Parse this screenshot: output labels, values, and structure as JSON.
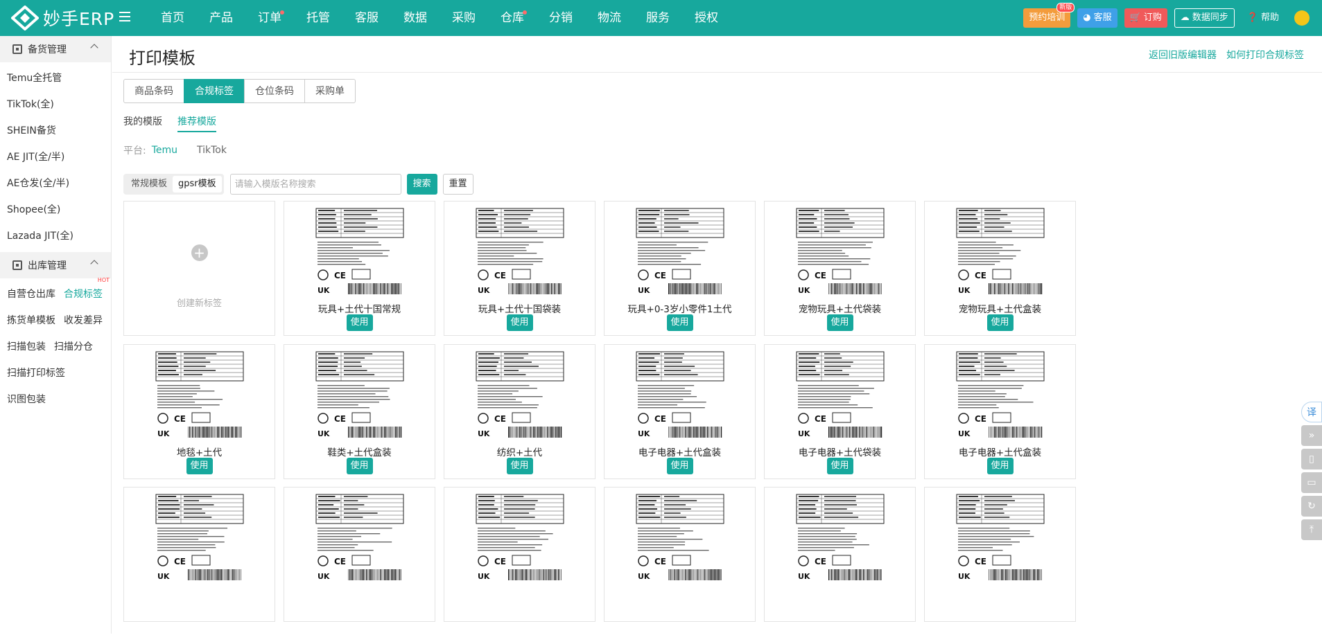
{
  "app": {
    "name": "妙手ERP"
  },
  "nav": {
    "items": [
      {
        "label": "首页",
        "dot": false
      },
      {
        "label": "产品",
        "dot": false
      },
      {
        "label": "订单",
        "dot": true
      },
      {
        "label": "托管",
        "dot": false
      },
      {
        "label": "客服",
        "dot": false
      },
      {
        "label": "数据",
        "dot": false
      },
      {
        "label": "采购",
        "dot": false
      },
      {
        "label": "仓库",
        "dot": true
      },
      {
        "label": "分销",
        "dot": false
      },
      {
        "label": "物流",
        "dot": false
      },
      {
        "label": "服务",
        "dot": false
      },
      {
        "label": "授权",
        "dot": false
      }
    ]
  },
  "topright": {
    "training": "预约培训",
    "new_badge": "新版",
    "service": "客服",
    "order": "订购",
    "sync": "数据同步",
    "help": "帮助"
  },
  "sidebar": {
    "groups": [
      {
        "title": "备货管理",
        "items": [
          {
            "label": "Temu全托管"
          },
          {
            "label": "TikTok(全)"
          },
          {
            "label": "SHEIN备货"
          },
          {
            "label": "AE JIT(全/半)"
          },
          {
            "label": "AE仓发(全/半)"
          },
          {
            "label": "Shopee(全)"
          },
          {
            "label": "Lazada JIT(全)"
          }
        ]
      },
      {
        "title": "出库管理",
        "items": [
          {
            "label": "自营仓出库"
          },
          {
            "label": "合规标签",
            "active": true,
            "hot": "HOT"
          },
          {
            "label": "拣货单模板"
          },
          {
            "label": "收发差异"
          },
          {
            "label": "扫描包装"
          },
          {
            "label": "扫描分仓"
          },
          {
            "label": "扫描打印标签"
          },
          {
            "label": "识图包装"
          }
        ]
      }
    ]
  },
  "page": {
    "title": "打印模板",
    "links": [
      "返回旧版编辑器",
      "如何打印合规标签"
    ],
    "seg_tabs": [
      "商品条码",
      "合规标签",
      "仓位条码",
      "采购单"
    ],
    "seg_active": 1,
    "sub_tabs": [
      "我的模版",
      "推荐模版"
    ],
    "sub_active": 1,
    "platform_label": "平台:",
    "platforms": [
      "Temu",
      "TikTok"
    ],
    "platform_active": 0,
    "mode_tabs": [
      "常规模板",
      "gpsr模板"
    ],
    "mode_active": 1,
    "search_placeholder": "请输入模版名称搜索",
    "search_button": "搜索",
    "reset_button": "重置"
  },
  "create_label": "创建新标签",
  "use_label": "使用",
  "templates": [
    {
      "name": "玩具+土代十国常规"
    },
    {
      "name": "玩具+土代十国袋装"
    },
    {
      "name": "玩具+0-3岁小零件1土代"
    },
    {
      "name": "宠物玩具+土代袋装"
    },
    {
      "name": "宠物玩具+土代盒装"
    },
    {
      "name": "地毯+土代"
    },
    {
      "name": "鞋类+土代盒装"
    },
    {
      "name": "纺织+土代"
    },
    {
      "name": "电子电器+土代盒装"
    },
    {
      "name": "电子电器+土代袋装"
    },
    {
      "name": "电子电器+土代盒装"
    },
    {
      "name": ""
    },
    {
      "name": ""
    },
    {
      "name": ""
    },
    {
      "name": ""
    },
    {
      "name": ""
    },
    {
      "name": ""
    }
  ],
  "colors": {
    "brand": "#17a89d",
    "training": "#f39c3c",
    "service": "#3fa0e8",
    "order": "#f05a5a"
  },
  "side_tools": [
    "translate-icon",
    "chevrons-icon",
    "phone-icon",
    "screen-icon",
    "refresh-icon",
    "top-icon"
  ]
}
